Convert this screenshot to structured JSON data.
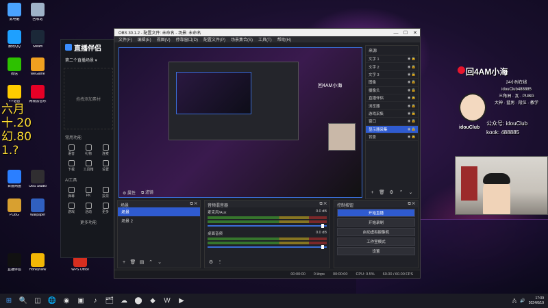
{
  "desktop": {
    "overlay_lines": [
      "六月",
      "十.20",
      "幻.80",
      "1.?"
    ],
    "icons": [
      {
        "label": "此电脑",
        "color": "#4aa3ff"
      },
      {
        "label": "回收站",
        "color": "#9fb3c8"
      },
      {
        "label": "腾讯QQ",
        "color": "#1ea0ff"
      },
      {
        "label": "Steam",
        "color": "#1b2838"
      },
      {
        "label": "微信",
        "color": "#2dc100"
      },
      {
        "label": "WeGame",
        "color": "#f0a020"
      },
      {
        "label": "YY语音",
        "color": "#ffcc00"
      },
      {
        "label": "网易云音乐",
        "color": "#e60026"
      },
      {
        "label": "百度网盘",
        "color": "#2b7fff"
      },
      {
        "label": "OBS Studio",
        "color": "#302e31"
      },
      {
        "label": "PUBG",
        "color": "#d8a030"
      },
      {
        "label": "Wallpaper",
        "color": "#3060c0"
      },
      {
        "label": "WPS Office",
        "color": "#d62e1f"
      },
      {
        "label": "Honeyview",
        "color": "#f2b705"
      },
      {
        "label": "直播伴侣",
        "color": "#111111"
      }
    ]
  },
  "companion": {
    "logo": "直播伴侣",
    "status_label": "第二个直播场景 ▾",
    "hint": "拖拽添加素材",
    "tools_title": "常用功能",
    "tools": [
      "语音",
      "礼物",
      "连麦",
      "下载",
      "工具箱",
      "设置"
    ],
    "apps_title": "Ai工具",
    "apps": [
      "弹幕",
      "PK",
      "投票",
      "游戏",
      "活动",
      "更多"
    ],
    "more_label": "更多功能"
  },
  "obs": {
    "title": "OBS 30.1.2 - 配置文件: 未命名 - 场景: 未命名",
    "menu": [
      "文件(F)",
      "编辑(E)",
      "视图(V)",
      "停靠窗口(D)",
      "配置文件(P)",
      "场景集合(S)",
      "工具(T)",
      "帮助(H)"
    ],
    "preview_brand": "回4AM小海",
    "mid_tools": [
      "⚙ 属性",
      "⧉ 滤镜"
    ],
    "sources_header": "来源",
    "sources": [
      {
        "label": "文字 1",
        "selected": false
      },
      {
        "label": "文字 2",
        "selected": false
      },
      {
        "label": "文字 3",
        "selected": false
      },
      {
        "label": "图像",
        "selected": false
      },
      {
        "label": "摄像头",
        "selected": false
      },
      {
        "label": "直播伴侣",
        "selected": false
      },
      {
        "label": "浏览器",
        "selected": false
      },
      {
        "label": "游戏采集",
        "selected": false
      },
      {
        "label": "窗口",
        "selected": false
      },
      {
        "label": "显示器采集",
        "selected": true
      },
      {
        "label": "背景",
        "selected": false
      }
    ],
    "scenes_header": "场景",
    "scenes": [
      {
        "label": "场景",
        "selected": true
      },
      {
        "label": "场景 2",
        "selected": false
      }
    ],
    "mixer_header": "音频混音器",
    "mixer": [
      {
        "label": "麦克风/Aux",
        "db": "0.0 dB"
      },
      {
        "label": "桌面音频",
        "db": "0.0 dB"
      }
    ],
    "controls_header": "控制按钮",
    "controls": [
      {
        "label": "开始直播",
        "primary": true
      },
      {
        "label": "开始录制",
        "primary": false
      },
      {
        "label": "启动虚拟摄像机",
        "primary": false
      },
      {
        "label": "工作室模式",
        "primary": false
      },
      {
        "label": "设置",
        "primary": false
      }
    ],
    "status": [
      "00:00:00",
      "0 kbps",
      "00:00:00",
      "CPU: 0.5%",
      "60.00 / 60.00 FPS"
    ]
  },
  "stream_info": {
    "name": "回4AM小海",
    "lines": [
      "24小时在线",
      "idouClub488885",
      "三角洲 · 瓦 · PUBG",
      "大神 · 猛男 · 段位 · 教学"
    ],
    "avatar_label": "idouClub",
    "contact": [
      "公众号: idouClub",
      "kook: 488885"
    ]
  },
  "taskbar": {
    "start": "⊞",
    "apps": [
      "🔍",
      "◫",
      "🌐",
      "◉",
      "▣",
      "♪",
      "🗂",
      "☁",
      "⬤",
      "◆",
      "W",
      "▶"
    ],
    "time": "17:09",
    "date": "2024/6/19"
  }
}
